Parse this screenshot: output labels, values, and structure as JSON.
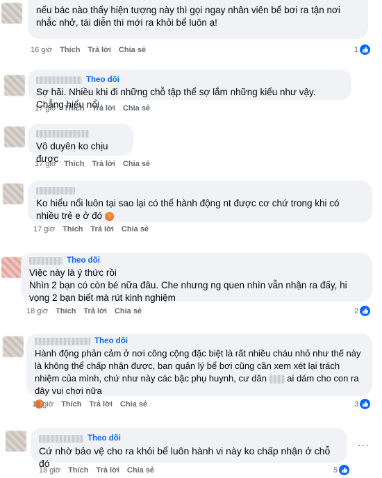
{
  "actions": {
    "like": "Thích",
    "reply": "Trả lời",
    "share": "Chia sẻ"
  },
  "comments": [
    {
      "text": "nếu bác nào thấy hiện tượng này thì gọi ngay nhân viên bể bơi ra tận nơi nhắc nhở, tái diễn thì mới ra khỏi bể luôn ạ!",
      "time": "16 giờ",
      "follow": "",
      "reactions": "1"
    },
    {
      "text": "Sợ hãi. Nhiều khi đi những chỗ tập thể sợ lắm những kiểu như vậy. Chẳng hiểu nổi",
      "time": "17 giờ",
      "follow": "Theo dõi",
      "reactions": ""
    },
    {
      "text": "Vô duyên ko chịu được",
      "time": "17 giờ",
      "follow": "",
      "reactions": ""
    },
    {
      "text": "Ko hiểu nổi luôn tại sao lại có thể hành động nt được cơ chứ trong khi có nhiều trẻ e ở đó",
      "time": "17 giờ",
      "follow": "",
      "reactions": ""
    },
    {
      "text_lines": [
        "Việc này là ý thức rồi",
        "Nhìn 2 bạn có còn bé nữa đâu. Che nhưng ng quen nhìn vẫn nhận ra đấy, hi vọng 2 bạn biết mà rút kinh nghiệm"
      ],
      "time": "18 giờ",
      "follow": "Theo dõi",
      "reactions": "2"
    },
    {
      "text_a": "Hành động phản cảm ở nơi công cộng đặc biệt là rất nhiều cháu nhỏ như thế này là không thể chấp nhận được, ban quản lý bể bơi cũng cần xem xét lại trách nhiệm của mình, chứ như này các bậc phụ huynh, cư dân",
      "text_b": "ai dám cho con ra đây vui chơi nữa",
      "time": "18 giờ",
      "follow": "Theo dõi",
      "reactions": "3"
    },
    {
      "text": "Cứ nhờ bảo vệ cho ra khỏi bể luôn hành vi này ko chấp nhận ở chỗ đó",
      "time": "18 giờ",
      "follow": "Theo dõi",
      "reactions": "5",
      "more": "···"
    }
  ],
  "colors": {
    "link": "#0866ff",
    "bubble": "#f0f2f5",
    "meta": "#65676b"
  }
}
